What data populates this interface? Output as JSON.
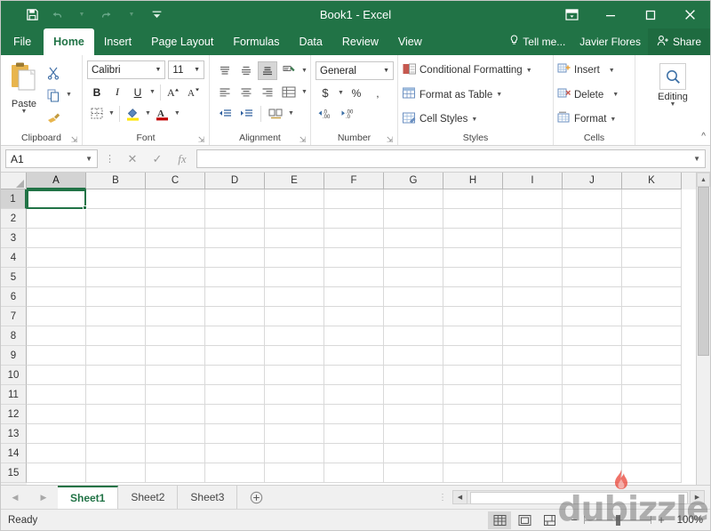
{
  "window": {
    "title": "Book1 - Excel",
    "quick_access": [
      {
        "name": "save",
        "label": "Save"
      },
      {
        "name": "undo",
        "label": "Undo"
      },
      {
        "name": "redo",
        "label": "Redo"
      },
      {
        "name": "customize",
        "label": "Customize Quick Access Toolbar"
      }
    ],
    "controls": [
      {
        "name": "ribbon-display-options",
        "label": "Ribbon Display Options"
      },
      {
        "name": "minimize",
        "label": "Minimize"
      },
      {
        "name": "maximize",
        "label": "Maximize"
      },
      {
        "name": "close",
        "label": "Close"
      }
    ],
    "accent_color": "#217346"
  },
  "ribbon": {
    "tabs": [
      {
        "label": "File",
        "active": false
      },
      {
        "label": "Home",
        "active": true
      },
      {
        "label": "Insert",
        "active": false
      },
      {
        "label": "Page Layout",
        "active": false
      },
      {
        "label": "Formulas",
        "active": false
      },
      {
        "label": "Data",
        "active": false
      },
      {
        "label": "Review",
        "active": false
      },
      {
        "label": "View",
        "active": false
      }
    ],
    "tell_me": "Tell me...",
    "user_name": "Javier Flores",
    "share_label": "Share",
    "collapse_label": "Collapse the Ribbon",
    "groups": {
      "clipboard": {
        "label": "Clipboard",
        "paste_label": "Paste",
        "cut_label": "Cut",
        "copy_label": "Copy",
        "format_painter_label": "Format Painter"
      },
      "font": {
        "label": "Font",
        "font_name": "Calibri",
        "font_size": "11",
        "bold_label": "B",
        "italic_label": "I",
        "underline_label": "U",
        "grow_font_label": "A",
        "shrink_font_label": "A",
        "borders_label": "Borders",
        "fill_color_label": "Fill Color",
        "font_color_label": "Font Color"
      },
      "alignment": {
        "label": "Alignment",
        "top_align_label": "Top Align",
        "middle_align_label": "Middle Align",
        "bottom_align_label": "Bottom Align",
        "orientation_label": "Orientation",
        "align_left_label": "Align Left",
        "center_label": "Center",
        "align_right_label": "Align Right",
        "wrap_text_label": "Wrap Text",
        "decrease_indent_label": "Decrease Indent",
        "increase_indent_label": "Increase Indent",
        "merge_center_label": "Merge & Center"
      },
      "number": {
        "label": "Number",
        "format": "General",
        "currency_label": "$",
        "percent_label": "%",
        "comma_label": ",",
        "increase_decimal_label": "Increase Decimal",
        "decrease_decimal_label": "Decrease Decimal"
      },
      "styles": {
        "label": "Styles",
        "items": [
          {
            "label": "Conditional Formatting"
          },
          {
            "label": "Format as Table"
          },
          {
            "label": "Cell Styles"
          }
        ]
      },
      "cells": {
        "label": "Cells",
        "items": [
          {
            "label": "Insert"
          },
          {
            "label": "Delete"
          },
          {
            "label": "Format"
          }
        ]
      },
      "editing": {
        "label": "Editing"
      }
    }
  },
  "formula_bar": {
    "name_box": "A1",
    "formula_value": "",
    "cancel_label": "Cancel",
    "enter_label": "Enter",
    "fx_label": "fx"
  },
  "grid": {
    "columns": [
      "A",
      "B",
      "C",
      "D",
      "E",
      "F",
      "G",
      "H",
      "I",
      "J",
      "K"
    ],
    "rows": [
      1,
      2,
      3,
      4,
      5,
      6,
      7,
      8,
      9,
      10,
      11,
      12,
      13,
      14,
      15
    ],
    "selected_cell": "A1",
    "selected_column": "A",
    "selected_row": 1
  },
  "sheets": {
    "tabs": [
      {
        "label": "Sheet1",
        "active": true
      },
      {
        "label": "Sheet2",
        "active": false
      },
      {
        "label": "Sheet3",
        "active": false
      }
    ],
    "add_sheet_label": "New sheet",
    "prev_label": "Previous",
    "next_label": "Next"
  },
  "status_bar": {
    "status": "Ready",
    "views": [
      {
        "name": "normal-view",
        "label": "Normal",
        "active": true
      },
      {
        "name": "page-layout-view",
        "label": "Page Layout",
        "active": false
      },
      {
        "name": "page-break-view",
        "label": "Page Break Preview",
        "active": false
      }
    ],
    "zoom_out_label": "−",
    "zoom_in_label": "+",
    "zoom_level": "100%"
  },
  "watermark": {
    "text": "dubizzle"
  }
}
